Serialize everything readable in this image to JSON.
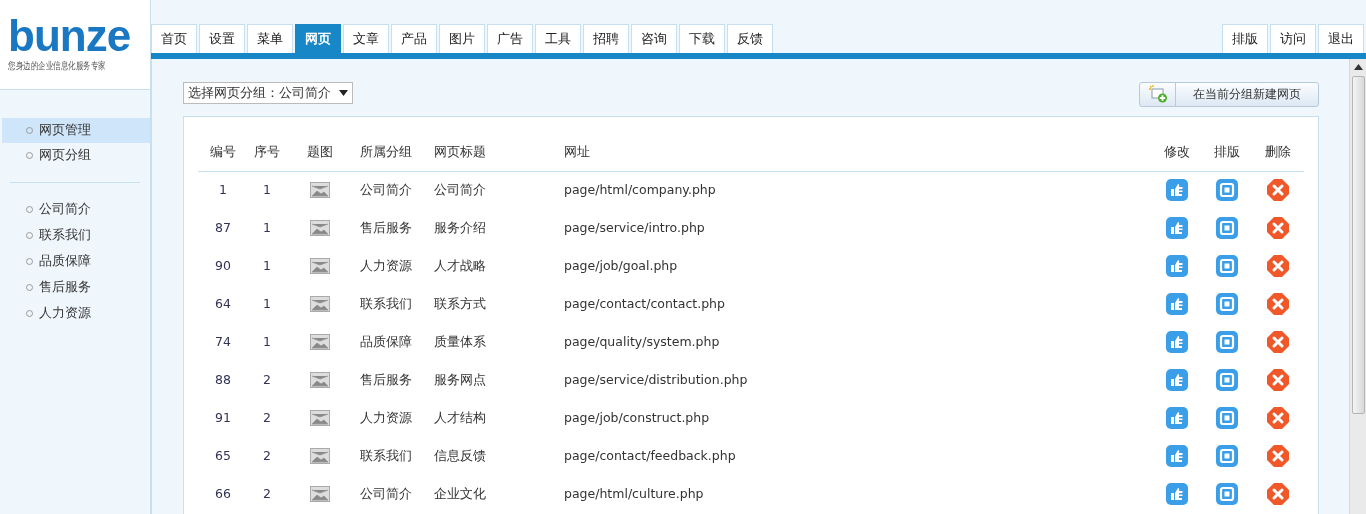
{
  "logo": {
    "name": "bunze",
    "slogan": "您身边的企业信息化服务专家"
  },
  "nav_tabs": [
    {
      "label": "首页",
      "selected": false
    },
    {
      "label": "设置",
      "selected": false
    },
    {
      "label": "菜单",
      "selected": false
    },
    {
      "label": "网页",
      "selected": true
    },
    {
      "label": "文章",
      "selected": false
    },
    {
      "label": "产品",
      "selected": false
    },
    {
      "label": "图片",
      "selected": false
    },
    {
      "label": "广告",
      "selected": false
    },
    {
      "label": "工具",
      "selected": false
    },
    {
      "label": "招聘",
      "selected": false
    },
    {
      "label": "咨询",
      "selected": false
    },
    {
      "label": "下载",
      "selected": false
    },
    {
      "label": "反馈",
      "selected": false
    }
  ],
  "right_tabs": [
    "排版",
    "访问",
    "退出"
  ],
  "sidebar": {
    "items": [
      {
        "label": "网页管理",
        "selected": true
      },
      {
        "label": "网页分组",
        "selected": false
      }
    ],
    "groups": [
      "公司简介",
      "联系我们",
      "品质保障",
      "售后服务",
      "人力资源"
    ]
  },
  "group_select": {
    "value": "选择网页分组：公司简介"
  },
  "new_button": {
    "label": "在当前分组新建网页"
  },
  "table": {
    "columns": [
      "编号",
      "序号",
      "题图",
      "所属分组",
      "网页标题",
      "网址",
      "修改",
      "排版",
      "删除"
    ],
    "rows": [
      [
        "1",
        "1",
        "",
        "公司简介",
        "公司简介",
        "page/html/company.php",
        "",
        "",
        ""
      ],
      [
        "87",
        "1",
        "",
        "售后服务",
        "服务介绍",
        "page/service/intro.php",
        "",
        "",
        ""
      ],
      [
        "90",
        "1",
        "",
        "人力资源",
        "人才战略",
        "page/job/goal.php",
        "",
        "",
        ""
      ],
      [
        "64",
        "1",
        "",
        "联系我们",
        "联系方式",
        "page/contact/contact.php",
        "",
        "",
        ""
      ],
      [
        "74",
        "1",
        "",
        "品质保障",
        "质量体系",
        "page/quality/system.php",
        "",
        "",
        ""
      ],
      [
        "88",
        "2",
        "",
        "售后服务",
        "服务网点",
        "page/service/distribution.php",
        "",
        "",
        ""
      ],
      [
        "91",
        "2",
        "",
        "人力资源",
        "人才结构",
        "page/job/construct.php",
        "",
        "",
        ""
      ],
      [
        "65",
        "2",
        "",
        "联系我们",
        "信息反馈",
        "page/contact/feedback.php",
        "",
        "",
        ""
      ],
      [
        "66",
        "2",
        "",
        "公司简介",
        "企业文化",
        "page/html/culture.php",
        "",
        "",
        ""
      ]
    ]
  }
}
